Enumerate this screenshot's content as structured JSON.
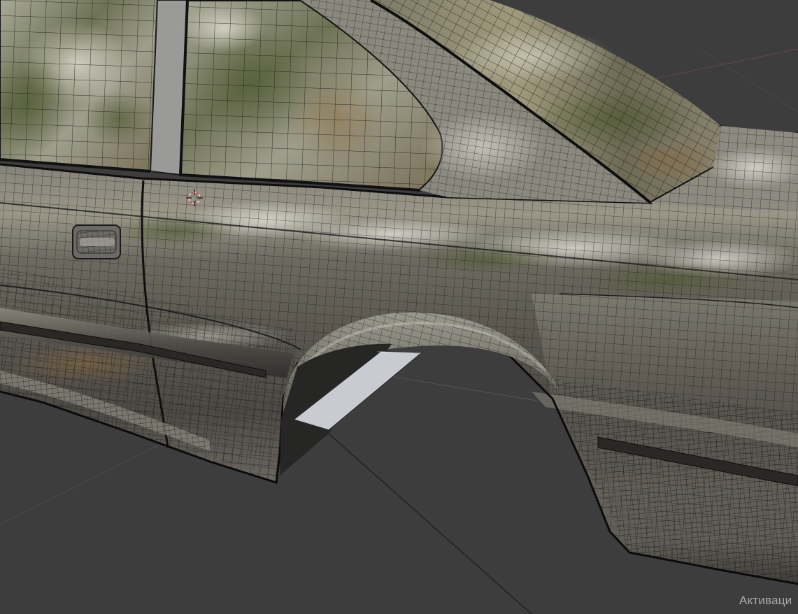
{
  "app": "Blender",
  "view": "3d-viewport-edit-mode-wireframe-overlay",
  "object": "car-body-mesh",
  "colors": {
    "background": "#3d3d3d",
    "car_paint": "#5a5650",
    "wire": "#141414",
    "window_tint": "#8a8a70",
    "axis_x": "#c05a5a"
  },
  "icons": [
    "3d-cursor-icon"
  ],
  "watermark": {
    "text": "Активаци"
  }
}
